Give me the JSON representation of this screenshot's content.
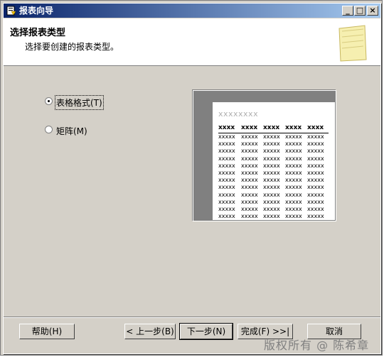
{
  "window": {
    "title": "报表向导"
  },
  "header": {
    "title": "选择报表类型",
    "subtitle": "选择要创建的报表类型。"
  },
  "options": [
    {
      "label": "表格格式(T)",
      "checked": true
    },
    {
      "label": "矩阵(M)",
      "checked": false
    }
  ],
  "preview": {
    "title": "xxxxxxxx",
    "headers": [
      "xxxx",
      "xxxx",
      "xxxx",
      "xxxx",
      "xxxx"
    ],
    "cell_text": "xxxxx",
    "rows": 12
  },
  "buttons": {
    "help": "帮助(H)",
    "back": "< 上一步(B)",
    "next": "下一步(N)",
    "finish": "完成(F) >>|",
    "cancel": "取消"
  },
  "watermark": "版权所有 @ 陈希章"
}
